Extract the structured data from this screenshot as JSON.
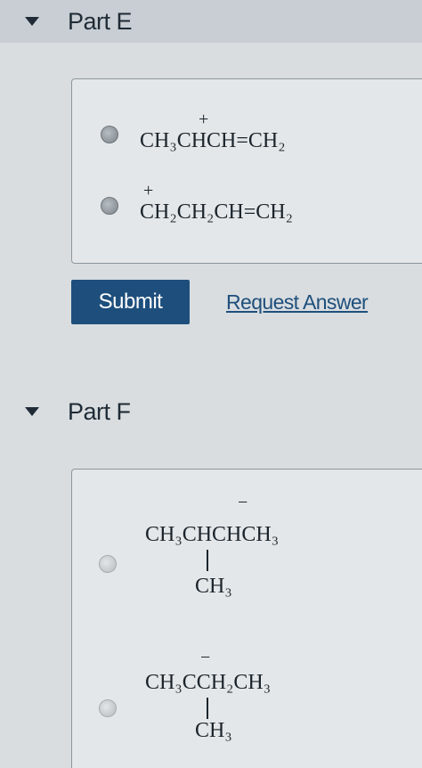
{
  "partE": {
    "title": "Part E",
    "options": [
      {
        "charge": "+",
        "formula": "CH₃CHCH=CH₂"
      },
      {
        "charge": "+",
        "formula": "CH₂CH₂CH=CH₂"
      }
    ],
    "submit_label": "Submit",
    "request_answer_label": "Request Answer"
  },
  "partF": {
    "title": "Part F",
    "options": [
      {
        "charge": "−",
        "formula": "CH₃CHCHCH₃",
        "branch": "CH₃"
      },
      {
        "charge": "−",
        "formula": "CH₃CCH₂CH₃",
        "branch": "CH₃"
      }
    ]
  },
  "colors": {
    "submit_bg": "#1e4f7c",
    "link": "#1e4f7c",
    "header_bg": "#c8ced3"
  }
}
